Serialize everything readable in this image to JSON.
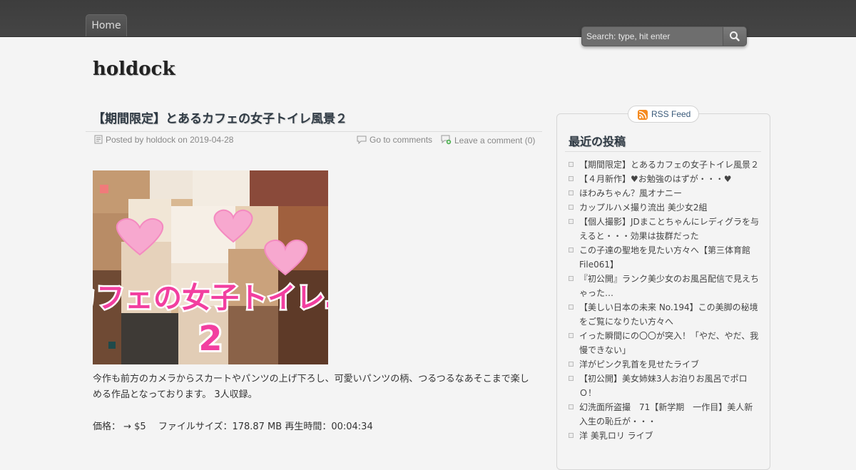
{
  "nav": {
    "home_label": "Home"
  },
  "search": {
    "placeholder": "Search: type, hit enter"
  },
  "site": {
    "title": "holdock"
  },
  "post": {
    "title": "【期間限定】とあるカフェの女子トイレ風景２",
    "posted_by": "Posted by holdock on 2019-04-28",
    "go_to_comments": "Go to comments",
    "leave_comment": "Leave a comment (0)",
    "thumbnail_caption": "カフェの女子トイレ…",
    "thumbnail_number": "2",
    "body": "今作も前方のカメラからスカートやパンツの上げ下ろし、可愛いパンツの柄、つるつるなあそこまで楽しめる作品となっております。 3人収録。",
    "price": "価格： → $5　 ファイルサイズ：178.87 MB 再生時間：00:04:34"
  },
  "sidebar": {
    "rss_label": "RSS Feed",
    "widget_title": "最近の投稿",
    "recent_posts": [
      "【期間限定】とあるカフェの女子トイレ風景２",
      "【４月新作】♥お勉強のはずが・・・♥",
      "ほわみちゃん？風オナニー",
      "カップルハメ撮り流出 美少女2組",
      "【個人撮影】JDまことちゃんにレディグラを与えると・・・効果は抜群だった",
      "この子達の聖地を見たい方々へ【第三体育館File061】",
      "『初公開』ランク美少女のお風呂配信で見えちゃった…",
      "【美しい日本の未来 No.194】この美脚の秘境をご覧になりたい方々へ",
      "イった瞬間にの〇〇が突入！「やだ、やだ、我慢できない」",
      "洋がピンク乳首を見せたライブ",
      "【初公開】美女姉妹3人お泊りお風呂でポロＯ！",
      "幻洗面所盗撮　71【新学期　一作目】美人新入生の恥丘が・・・",
      "洋 美乳ロリ ライブ"
    ]
  },
  "colors": {
    "topbar": "#404040",
    "background": "#f4f4f4",
    "heading": "#2f3a44",
    "link": "#3a5a7a",
    "heart": "#f7a8cf",
    "caption_pink": "#f23fa0"
  },
  "icons": [
    "search-icon",
    "post-author-icon",
    "comments-icon",
    "add-comment-icon",
    "rss-icon"
  ]
}
